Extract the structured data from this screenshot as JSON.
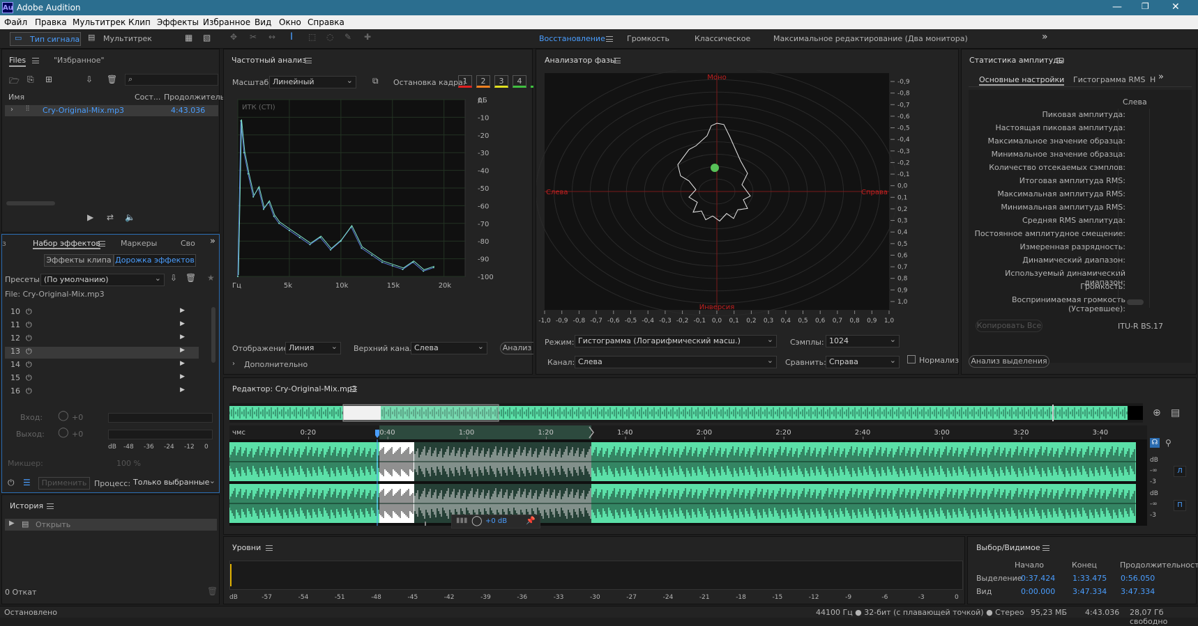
{
  "app": {
    "logo": "Au",
    "title": "Adobe Audition",
    "min": "—",
    "max": "❐",
    "close": "✕"
  },
  "menu": [
    "Файл",
    "Правка",
    "Мультитрек",
    "Клип",
    "Эффекты",
    "Избранное",
    "Вид",
    "Окно",
    "Справка"
  ],
  "toolbar": {
    "waveform": "Тип сигнала",
    "multitrack": "Мультитрек"
  },
  "workspaces": {
    "items": [
      "Восстановление",
      "Громкость",
      "Классическое",
      "Максимальное редактирование (Два монитора)"
    ],
    "active": 0,
    "more": "»"
  },
  "files": {
    "tab": "Files",
    "fav": "\"Избранное\"",
    "col_name": "Имя",
    "col_state": "Сост...",
    "col_dur": "Продолжительн",
    "file": "Cry-Original-Mix.mp3",
    "dur": "4:43.036"
  },
  "effects": {
    "tab_prev": "з",
    "tab": "Набор эффектов",
    "tab2": "Маркеры",
    "tab3": "Сво",
    "sub1": "Эффекты клипа",
    "sub2": "Дорожка эффектов",
    "presets_label": "Пресеты:",
    "preset": "(По умолчанию)",
    "file_label": "File: Cry-Original-Mix.mp3",
    "rows": [
      "10",
      "11",
      "12",
      "13",
      "14",
      "15",
      "16"
    ],
    "in_label": "Вход:",
    "out_label": "Выход:",
    "in_val": "+0",
    "out_val": "+0",
    "meter_ticks": [
      "dB",
      "-48",
      "-36",
      "-24",
      "-12",
      "0"
    ],
    "mixer_label": "Микшер:",
    "mixer_val": "100 %",
    "apply": "Применить",
    "process_label": "Процесс:",
    "process": "Только выбранные"
  },
  "history": {
    "title": "История",
    "item": "Открыть",
    "undo": "0 Откат"
  },
  "status": {
    "left": "Остановлено",
    "right": [
      "44100 Гц ● 32-бит (с плавающей точкой) ● Стерео",
      "95,23 МБ",
      "4:43.036",
      "28,07 Гб свободно"
    ]
  },
  "freq": {
    "title": "Частотный анализ",
    "scale_label": "Масштаб:",
    "scale": "Линейный",
    "freeze_label": "Остановка кадра:",
    "frames": [
      "1",
      "2",
      "3",
      "4"
    ],
    "frame_colors": [
      "#e02020",
      "#f08020",
      "#e0e020",
      "#40c040"
    ],
    "overlay": "ИТК (CTI)",
    "display_label": "Отображение:",
    "display": "Линия",
    "channel_label": "Верхний канал:",
    "channel": "Слева",
    "analyze": "Анализ",
    "advanced": "Дополнительно",
    "ylabels": [
      "дБ",
      "0",
      "-10",
      "-20",
      "-30",
      "-40",
      "-50",
      "-60",
      "-70",
      "-80",
      "-90",
      "-100"
    ],
    "xlabels": [
      "Гц",
      "5k",
      "10k",
      "15k",
      "20k"
    ]
  },
  "phase": {
    "title": "Анализатор фазы",
    "top": "Моно",
    "bottom": "Инверсия",
    "left": "Слева",
    "right": "Справа",
    "rlabels": [
      "-0,9",
      "-0,8",
      "-0,7",
      "-0,6",
      "-0,5",
      "-0,4",
      "-0,3",
      "-0,2",
      "-0,1",
      "0,0",
      "0,1",
      "0,2",
      "0,3",
      "0,4",
      "0,5",
      "0,6",
      "0,7",
      "0,8",
      "0,9",
      "1,0"
    ],
    "xlabels": [
      "-1,0",
      "-0,9",
      "-0,8",
      "-0,7",
      "-0,6",
      "-0,5",
      "-0,4",
      "-0,3",
      "-0,2",
      "-0,1",
      "0,0",
      "0,1",
      "0,2",
      "0,3",
      "0,4",
      "0,5",
      "0,6",
      "0,7",
      "0,8",
      "0,9",
      "1,0"
    ],
    "mode_label": "Режим:",
    "mode": "Гистограмма (Логарифмический масш.)",
    "samples_label": "Сэмплы:",
    "samples": "1024",
    "channel_label": "Канал:",
    "channel": "Слева",
    "compare_label": "Сравнить:",
    "compare": "Справа",
    "normalize": "Нормализ"
  },
  "amp": {
    "title": "Статистика амплитуды",
    "tab1": "Основные настройки",
    "tab2": "Гистограмма RMS",
    "tab3": "Н",
    "col": "Слева",
    "rows": [
      "Пиковая амплитуда:",
      "Настоящая пиковая амплитуда:",
      "Максимальное значение образца:",
      "Минимальное значение образца:",
      "Количество отсекаемых сэмплов:",
      "Итоговая амплитуда RMS:",
      "Максимальная амплитуда RMS:",
      "Минимальная амплитуда RMS:",
      "Средняя RMS амплитуда:",
      "Постоянное амплитудное смещение:",
      "Измеренная разрядность:",
      "Динамический диапазон:",
      "Используемый динамический диапазон:",
      "Громкость:",
      "Воспринимаемая громкость (Устаревшее):"
    ],
    "copy": "Копировать Все",
    "std": "ITU-R BS.17",
    "analyze": "Анализ выделения"
  },
  "editor": {
    "title": "Редактор: Cry-Original-Mix.mp3",
    "ruler": [
      "чмс",
      "0:20",
      "0:40",
      "1:00",
      "1:20",
      "1:40",
      "2:00",
      "2:20",
      "2:40",
      "3:00",
      "3:20",
      "3:40"
    ],
    "db_labels": [
      "dB",
      "-∞",
      "-3",
      "dB",
      "-∞",
      "-3"
    ],
    "ch_l": "Л",
    "ch_r": "П",
    "gain": "+0 dB"
  },
  "levels": {
    "title": "Уровни",
    "ticks": [
      "dB",
      "-57",
      "-54",
      "-51",
      "-48",
      "-45",
      "-42",
      "-39",
      "-36",
      "-33",
      "-30",
      "-27",
      "-24",
      "-21",
      "-18",
      "-15",
      "-12",
      "-9",
      "-6",
      "-3",
      "0"
    ]
  },
  "selview": {
    "title": "Выбор/Видимое",
    "h_start": "Начало",
    "h_end": "Конец",
    "h_dur": "Продолжительность",
    "r1": "Выделение",
    "r2": "Вид",
    "sel": [
      "0:37.424",
      "1:33.475",
      "0:56.050"
    ],
    "view": [
      "0:00.000",
      "3:47.334",
      "3:47.334"
    ]
  },
  "chart_data": {
    "type": "line",
    "xlabel": "Гц",
    "ylabel": "дБ",
    "xlim": [
      0,
      22050
    ],
    "ylim": [
      -100,
      0
    ],
    "series": [
      {
        "values": [
          [
            0,
            -100
          ],
          [
            300,
            -12
          ],
          [
            600,
            -30
          ],
          [
            1000,
            -42
          ],
          [
            1500,
            -55
          ],
          [
            2000,
            -50
          ],
          [
            2500,
            -62
          ],
          [
            3000,
            -58
          ],
          [
            3500,
            -66
          ],
          [
            4000,
            -70
          ],
          [
            5000,
            -74
          ],
          [
            6000,
            -78
          ],
          [
            7000,
            -82
          ],
          [
            8000,
            -78
          ],
          [
            9000,
            -85
          ],
          [
            10000,
            -80
          ],
          [
            11000,
            -72
          ],
          [
            12000,
            -84
          ],
          [
            13000,
            -88
          ],
          [
            14000,
            -92
          ],
          [
            15000,
            -94
          ],
          [
            16000,
            -96
          ],
          [
            17000,
            -92
          ],
          [
            18000,
            -97
          ],
          [
            19000,
            -95
          ]
        ]
      }
    ]
  }
}
